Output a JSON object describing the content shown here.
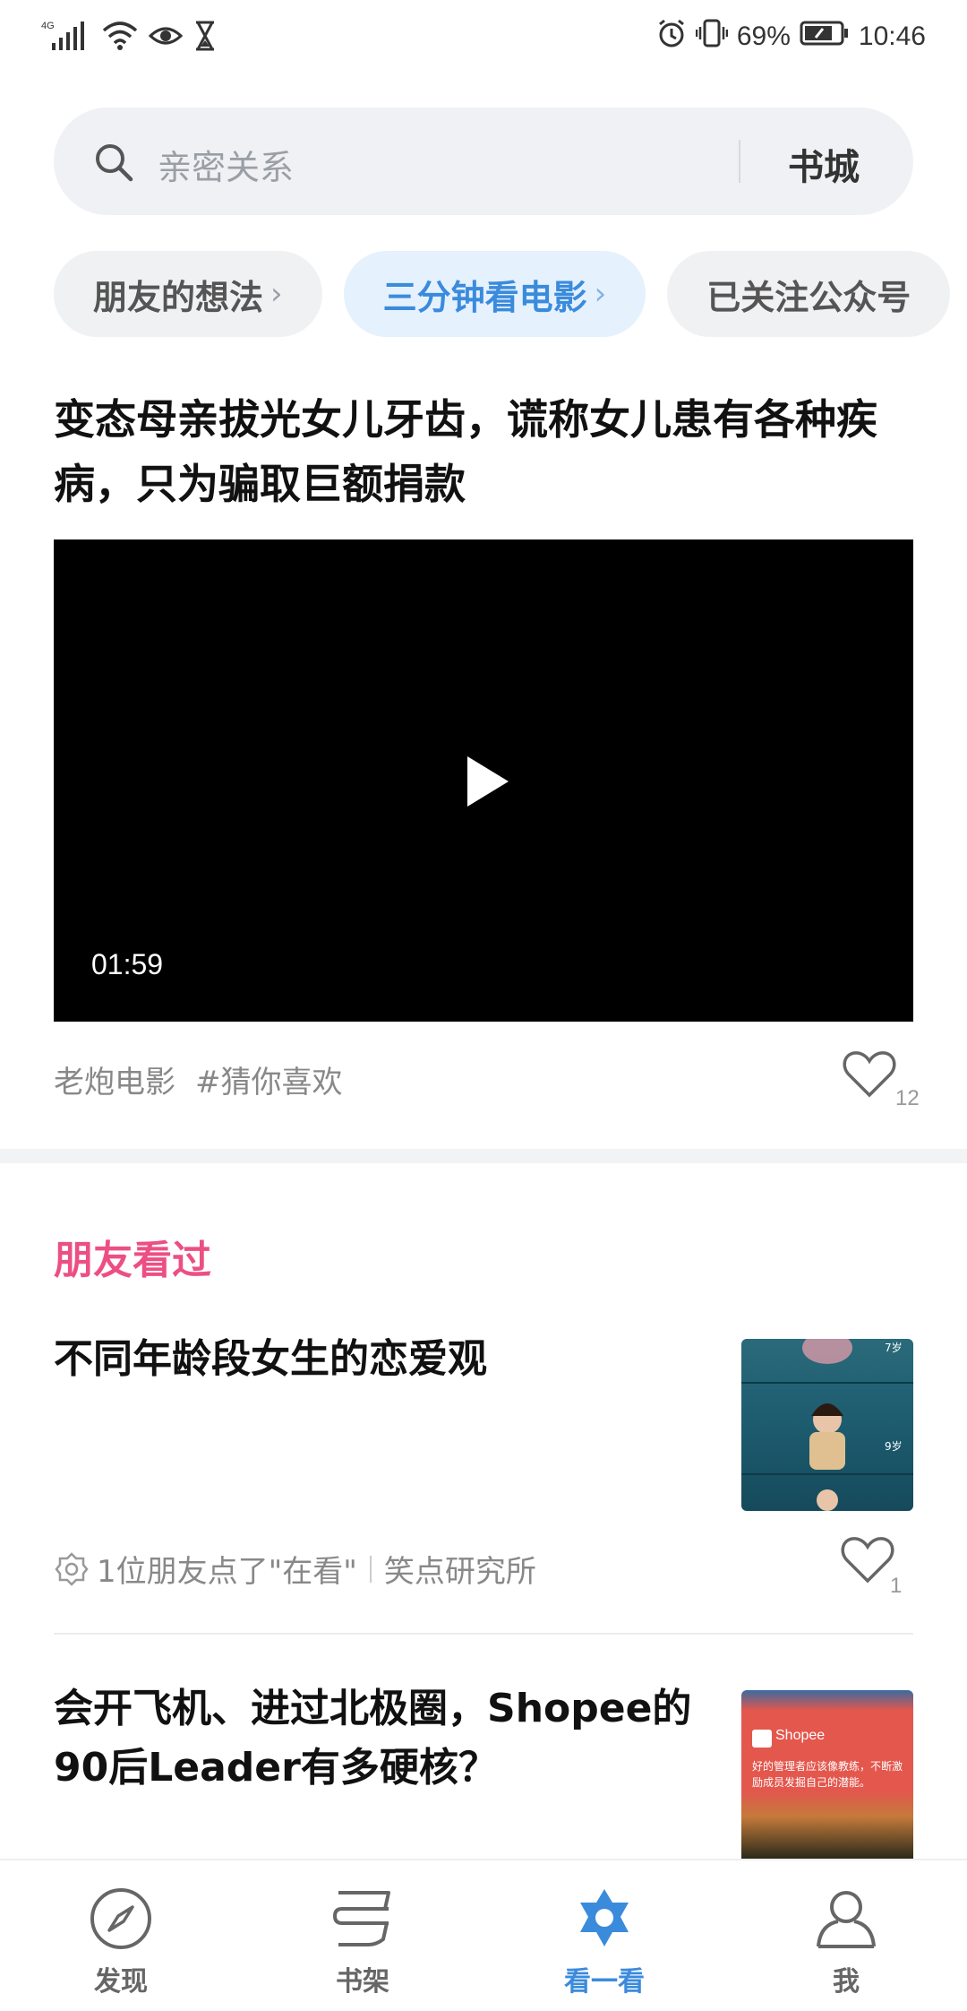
{
  "status_bar": {
    "network": "4G",
    "battery": "69%",
    "time": "10:46"
  },
  "search": {
    "placeholder": "亲密关系",
    "bookstore_label": "书城"
  },
  "chips": [
    {
      "label": "朋友的想法"
    },
    {
      "label": "三分钟看电影"
    },
    {
      "label": "已关注公众号"
    }
  ],
  "featured": {
    "title": "变态母亲拔光女儿牙齿，谎称女儿患有各种疾病，只为骗取巨额捐款",
    "duration": "01:59",
    "source": "老炮电影",
    "tag": "#猜你喜欢",
    "likes": "12"
  },
  "friends_section": {
    "title": "朋友看过"
  },
  "articles": [
    {
      "title": "不同年龄段女生的恋爱观",
      "friends_text": "1位朋友点了\"在看\"",
      "source": "笑点研究所",
      "likes": "1",
      "thumb_labels": [
        "7岁",
        "9岁"
      ]
    },
    {
      "title": "会开飞机、进过北极圈，Shopee的90后Leader有多硬核？",
      "thumb_brand": "Shopee",
      "thumb_caption": "好的管理者应该像教练，不断激励成员发掘自己的潜能。"
    }
  ],
  "bottom_nav": [
    {
      "label": "发现",
      "icon": "compass-icon"
    },
    {
      "label": "书架",
      "icon": "bookshelf-icon"
    },
    {
      "label": "看一看",
      "icon": "star-icon"
    },
    {
      "label": "我",
      "icon": "person-icon"
    }
  ],
  "colors": {
    "accent": "#3b8bdc",
    "section_title": "#ec4f83"
  }
}
